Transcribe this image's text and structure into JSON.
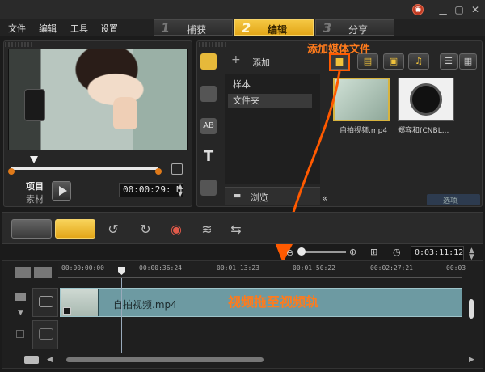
{
  "menu": [
    "文件",
    "编辑",
    "工具",
    "设置"
  ],
  "steps": [
    {
      "num": "1",
      "label": "捕获"
    },
    {
      "num": "2",
      "label": "编辑"
    },
    {
      "num": "3",
      "label": "分享"
    }
  ],
  "preview": {
    "project_label": "项目",
    "clip_label": "素材",
    "timecode": "00:00:29:",
    "timecode_unit": "M"
  },
  "library": {
    "add_label": "添加",
    "folders": [
      "样本",
      "文件夹"
    ],
    "browse_label": "浏览",
    "options_label": "选项",
    "thumbs": [
      {
        "caption": "自拍视频.mp4"
      },
      {
        "caption": "郑容和(CNBL..."
      }
    ]
  },
  "annotations": {
    "add_media": "添加媒体文件",
    "drag_to_track": "视频拖至视频轨"
  },
  "timeline": {
    "duration": "0:03:11:12",
    "ruler": [
      "00:00:00:00",
      "00:00:36:24",
      "00:01:13:23",
      "00:01:50:22",
      "00:02:27:21",
      "00:03"
    ],
    "clip_name": "自拍视频.mp4"
  },
  "colors": {
    "accent": "#f5c742",
    "annotation": "#ff7b1c",
    "clip": "#6d9aa2"
  }
}
